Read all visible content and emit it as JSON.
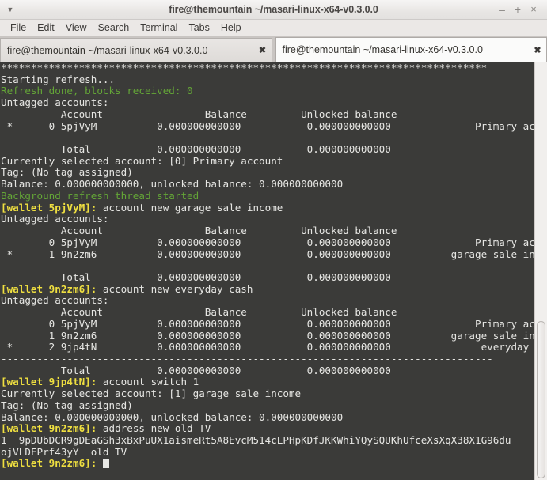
{
  "window": {
    "title": "fire@themountain ~/masari-linux-x64-v0.3.0.0",
    "menu_arrow_icon": "▼",
    "minimize_label": "–",
    "maximize_label": "+",
    "close_label": "×"
  },
  "menubar": {
    "items": [
      {
        "label": "File"
      },
      {
        "label": "Edit"
      },
      {
        "label": "View"
      },
      {
        "label": "Search"
      },
      {
        "label": "Terminal"
      },
      {
        "label": "Tabs"
      },
      {
        "label": "Help"
      }
    ]
  },
  "tabs": [
    {
      "label": "fire@themountain ~/masari-linux-x64-v0.3.0.0",
      "close_label": "✖",
      "active": false
    },
    {
      "label": "fire@themountain ~/masari-linux-x64-v0.3.0.0",
      "close_label": "✖",
      "active": true
    }
  ],
  "colors": {
    "terminal_background": "#3b3b39",
    "terminal_foreground": "#e6e6e3",
    "status_green": "#64a637",
    "prompt_yellow": "#f0e040",
    "titlebar_background": "#e8e6e4",
    "tabbar_background": "#c9c5c2"
  },
  "terminal": {
    "scrollbar_thumb_position": "bottom",
    "cursor_visible": true,
    "lines": [
      {
        "color": "white",
        "text": "*********************************************************************************"
      },
      {
        "color": "white",
        "text": "Starting refresh..."
      },
      {
        "color": "green",
        "text": "Refresh done, blocks received: 0"
      },
      {
        "color": "white",
        "text": "Untagged accounts:"
      },
      {
        "color": "white",
        "text": "          Account                 Balance         Unlocked balance                        Label"
      },
      {
        "color": "white",
        "text": " *      0 5pjVyM          0.000000000000           0.000000000000              Primary account"
      },
      {
        "color": "white",
        "text": "----------------------------------------------------------------------------------"
      },
      {
        "color": "white",
        "text": "          Total           0.000000000000           0.000000000000"
      },
      {
        "color": "white",
        "text": "Currently selected account: [0] Primary account"
      },
      {
        "color": "white",
        "text": "Tag: (No tag assigned)"
      },
      {
        "color": "white",
        "text": "Balance: 0.000000000000, unlocked balance: 0.000000000000"
      },
      {
        "color": "green",
        "text": "Background refresh thread started"
      },
      {
        "prompt": "[wallet 5pjVyM]:",
        "text": " account new garage sale income"
      },
      {
        "color": "white",
        "text": "Untagged accounts:"
      },
      {
        "color": "white",
        "text": "          Account                 Balance         Unlocked balance                        Label"
      },
      {
        "color": "white",
        "text": "        0 5pjVyM          0.000000000000           0.000000000000              Primary account"
      },
      {
        "color": "white",
        "text": " *      1 9n2zm6          0.000000000000           0.000000000000          garage sale income"
      },
      {
        "color": "white",
        "text": "----------------------------------------------------------------------------------"
      },
      {
        "color": "white",
        "text": "          Total           0.000000000000           0.000000000000"
      },
      {
        "prompt": "[wallet 9n2zm6]:",
        "text": " account new everyday cash"
      },
      {
        "color": "white",
        "text": "Untagged accounts:"
      },
      {
        "color": "white",
        "text": "          Account                 Balance         Unlocked balance                        Label"
      },
      {
        "color": "white",
        "text": "        0 5pjVyM          0.000000000000           0.000000000000              Primary account"
      },
      {
        "color": "white",
        "text": "        1 9n2zm6          0.000000000000           0.000000000000          garage sale income"
      },
      {
        "color": "white",
        "text": " *      2 9jp4tN          0.000000000000           0.000000000000               everyday cash"
      },
      {
        "color": "white",
        "text": "----------------------------------------------------------------------------------"
      },
      {
        "color": "white",
        "text": "          Total           0.000000000000           0.000000000000"
      },
      {
        "prompt": "[wallet 9jp4tN]:",
        "text": " account switch 1"
      },
      {
        "color": "white",
        "text": "Currently selected account: [1] garage sale income"
      },
      {
        "color": "white",
        "text": "Tag: (No tag assigned)"
      },
      {
        "color": "white",
        "text": "Balance: 0.000000000000, unlocked balance: 0.000000000000"
      },
      {
        "prompt": "[wallet 9n2zm6]:",
        "text": " address new old TV"
      },
      {
        "color": "white",
        "text": "1  9pDUbDCR9gDEaGSh3xBxPuUX1aismeRt5A8EvcM514cLPHpKDfJKKWhiYQySQUKhUfceXsXqX38X1G96du"
      },
      {
        "color": "white",
        "text": "ojVLDFPrf43yY  old TV"
      },
      {
        "prompt": "[wallet 9n2zm6]:",
        "text": " ",
        "cursor": true
      }
    ]
  }
}
